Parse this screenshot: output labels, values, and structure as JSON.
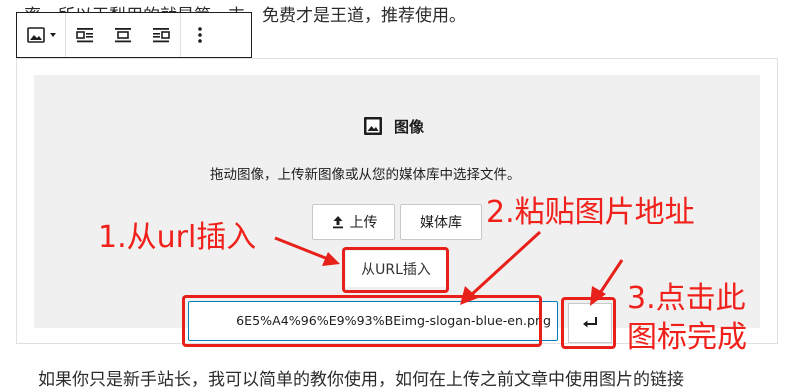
{
  "paragraph": {
    "top": "率，所以王梨用的就是第一支，免费才是王道，推荐使用。",
    "bottom": "如果你只是新手站长，我可以简单的教你使用，如何在上传之前文章中使用图片的链接"
  },
  "toolbar": {
    "items": [
      {
        "icon": "image-icon"
      },
      {
        "icon": "chevron-down-icon"
      },
      {
        "icon": "align-left-icon"
      },
      {
        "icon": "align-center-icon"
      },
      {
        "icon": "align-right-icon"
      },
      {
        "icon": "more-vertical-icon"
      }
    ]
  },
  "image_block": {
    "title": "图像",
    "instructions": "拖动图像，上传新图像或从您的媒体库中选择文件。",
    "upload_label": "上传",
    "media_library_label": "媒体库",
    "insert_url_label": "从URL插入",
    "url_value": "6E5%A4%96%E9%93%BEimg-slogan-blue-en.png"
  },
  "annotations": {
    "step1": "1.从url插入",
    "step2": "2.粘贴图片地址",
    "step3_line1": "3.点击此",
    "step3_line2": "图标完成"
  },
  "colors": {
    "annotation": "#e8201a",
    "input_border": "#007cba"
  }
}
